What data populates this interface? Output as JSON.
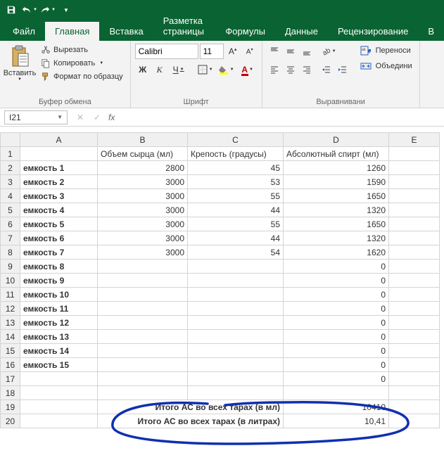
{
  "titlebar": {
    "qat": [
      "save-icon",
      "undo-icon",
      "redo-icon",
      "customize-icon"
    ]
  },
  "tabs": {
    "file": "Файл",
    "home": "Главная",
    "insert": "Вставка",
    "pagelayout": "Разметка страницы",
    "formulas": "Формулы",
    "data": "Данные",
    "review": "Рецензирование",
    "view_prefix": "В"
  },
  "ribbon": {
    "clipboard": {
      "paste": "Вставить",
      "cut": "Вырезать",
      "copy": "Копировать",
      "format_painter": "Формат по образцу",
      "label": "Буфер обмена"
    },
    "font": {
      "name": "Calibri",
      "size": "11",
      "label": "Шрифт",
      "bold_btn": "Ж",
      "italic_btn": "К",
      "underline_btn": "Ч"
    },
    "align": {
      "label": "Выравнивани",
      "wrap": "Переноси",
      "merge": "Объедини"
    }
  },
  "formula_bar": {
    "name_box": "I21",
    "fx": "fx",
    "value": ""
  },
  "grid": {
    "columns": [
      "A",
      "B",
      "C",
      "D",
      "E"
    ],
    "headers": {
      "b": "Объем сырца (мл)",
      "c": "Крепость (градусы)",
      "d": "Абсолютный спирт (мл)"
    },
    "rows": [
      {
        "a": "емкость 1",
        "b": "2800",
        "c": "45",
        "d": "1260"
      },
      {
        "a": "емкость 2",
        "b": "3000",
        "c": "53",
        "d": "1590"
      },
      {
        "a": "емкость 3",
        "b": "3000",
        "c": "55",
        "d": "1650"
      },
      {
        "a": "емкость 4",
        "b": "3000",
        "c": "44",
        "d": "1320"
      },
      {
        "a": "емкость 5",
        "b": "3000",
        "c": "55",
        "d": "1650"
      },
      {
        "a": "емкость 6",
        "b": "3000",
        "c": "44",
        "d": "1320"
      },
      {
        "a": "емкость 7",
        "b": "3000",
        "c": "54",
        "d": "1620"
      },
      {
        "a": "емкость 8",
        "b": "",
        "c": "",
        "d": "0"
      },
      {
        "a": "емкость 9",
        "b": "",
        "c": "",
        "d": "0"
      },
      {
        "a": "емкость 10",
        "b": "",
        "c": "",
        "d": "0"
      },
      {
        "a": "емкость 11",
        "b": "",
        "c": "",
        "d": "0"
      },
      {
        "a": "емкость 12",
        "b": "",
        "c": "",
        "d": "0"
      },
      {
        "a": "емкость 13",
        "b": "",
        "c": "",
        "d": "0"
      },
      {
        "a": "емкость 14",
        "b": "",
        "c": "",
        "d": "0"
      },
      {
        "a": "емкость 15",
        "b": "",
        "c": "",
        "d": "0"
      },
      {
        "a": "",
        "b": "",
        "c": "",
        "d": "0"
      }
    ],
    "totals": {
      "ml_label": "Итого АС во всех тарах  (в мл)",
      "ml_value": "10410",
      "l_label": "Итого АС во всех тарах  (в литрах)",
      "l_value": "10,41"
    }
  }
}
